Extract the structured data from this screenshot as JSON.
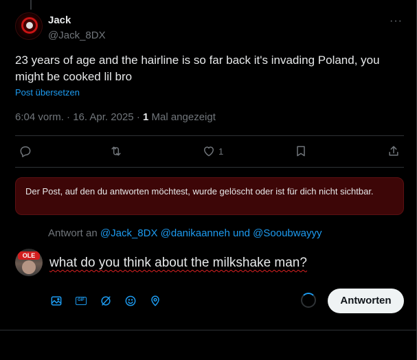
{
  "post": {
    "author_name": "Jack",
    "author_handle": "@Jack_8DX",
    "avatar_badge": "JACK_8DX",
    "more_label": "···",
    "text": "23 years of age and the hairline is so far back it's invading Poland, you might be cooked lil bro",
    "translate_label": "Post übersetzen",
    "time": "6:04 vorm.",
    "date": "16. Apr. 2025",
    "views_count": "1",
    "views_label": "Mal angezeigt"
  },
  "actions": {
    "like_count": "1",
    "icons": [
      "reply-icon",
      "repost-icon",
      "like-icon",
      "bookmark-icon",
      "share-icon"
    ]
  },
  "notice": {
    "text": "Der Post, auf den du antworten möchtest, wurde gelöscht oder ist für dich nicht sichtbar."
  },
  "reply": {
    "prefix": "Antwort an",
    "mention1": "@Jack_8DX",
    "mention2": "@danikaanneh",
    "conjunction": "und",
    "mention3": "@Sooubwayyy",
    "avatar_label": "OLE",
    "draft_text": "what do you think about the milkshake man?",
    "submit_label": "Antworten"
  },
  "composer_tools": [
    "image-icon",
    "gif-icon",
    "grok-icon",
    "emoji-icon",
    "location-icon"
  ],
  "colors": {
    "accent": "#1d9bf0",
    "background": "#000000",
    "notice_bg": "#3d0607",
    "muted": "#71767b"
  }
}
